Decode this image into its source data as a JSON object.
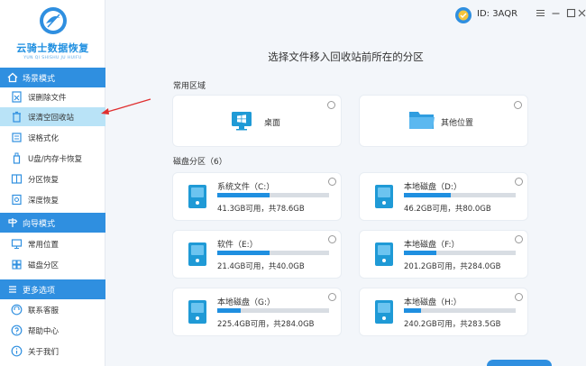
{
  "app": {
    "logo_title": "云骑士数据恢复",
    "logo_sub": "YUN QI SHISHU JU HUIFU",
    "user_id": "ID: 3AQR"
  },
  "sidebar": {
    "sections": [
      {
        "title": "场景模式",
        "items": [
          {
            "label": "误删除文件",
            "icon": "delete-file-icon"
          },
          {
            "label": "误清空回收站",
            "icon": "recycle-bin-icon",
            "active": true
          },
          {
            "label": "误格式化",
            "icon": "format-icon"
          },
          {
            "label": "U盘/内存卡恢复",
            "icon": "usb-icon"
          },
          {
            "label": "分区恢复",
            "icon": "partition-icon"
          },
          {
            "label": "深度恢复",
            "icon": "deep-recovery-icon"
          }
        ]
      },
      {
        "title": "向导模式",
        "items": [
          {
            "label": "常用位置",
            "icon": "common-location-icon"
          },
          {
            "label": "磁盘分区",
            "icon": "disk-partition-icon"
          }
        ]
      },
      {
        "title": "更多选项",
        "items": [
          {
            "label": "联系客服",
            "icon": "headset-icon"
          },
          {
            "label": "帮助中心",
            "icon": "help-icon"
          },
          {
            "label": "关于我们",
            "icon": "info-icon"
          }
        ]
      }
    ]
  },
  "main": {
    "title": "选择文件移入回收站前所在的分区",
    "common_label": "常用区域",
    "common": [
      {
        "label": "桌面",
        "icon": "windows-desktop-icon"
      },
      {
        "label": "其他位置",
        "icon": "folder-icon"
      }
    ],
    "disk_label": "磁盘分区（6）",
    "drives": [
      {
        "name": "系统文件（C:）",
        "info": "41.3GB可用，共78.6GB",
        "used_fraction": 0.47
      },
      {
        "name": "本地磁盘（D:）",
        "info": "46.2GB可用，共80.0GB",
        "used_fraction": 0.42
      },
      {
        "name": "软件（E:）",
        "info": "21.4GB可用，共40.0GB",
        "used_fraction": 0.47
      },
      {
        "name": "本地磁盘（F:）",
        "info": "201.2GB可用，共284.0GB",
        "used_fraction": 0.29
      },
      {
        "name": "本地磁盘（G:）",
        "info": "225.4GB可用，共284.0GB",
        "used_fraction": 0.21
      },
      {
        "name": "本地磁盘（H:）",
        "info": "240.2GB可用，共283.5GB",
        "used_fraction": 0.15
      }
    ]
  },
  "colors": {
    "accent": "#2f8fe0",
    "active_bg": "#b9e3f7",
    "arrow": "#e03030"
  }
}
